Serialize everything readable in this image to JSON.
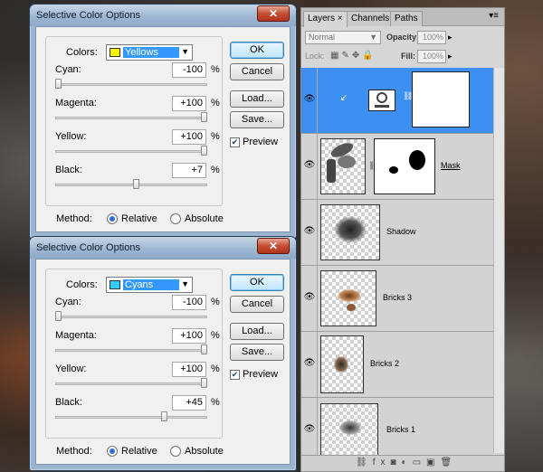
{
  "dialogs": [
    {
      "title": "Selective Color Options",
      "colors_label": "Colors:",
      "colors_value": "Yellows",
      "swatch": "#f5f500",
      "sliders": [
        {
          "label": "Cyan:",
          "value": "-100",
          "unit": "%",
          "level": 0.0
        },
        {
          "label": "Magenta:",
          "value": "+100",
          "unit": "%",
          "level": 1.0
        },
        {
          "label": "Yellow:",
          "value": "+100",
          "unit": "%",
          "level": 1.0
        },
        {
          "label": "Black:",
          "value": "+7",
          "unit": "%",
          "level": 0.535
        }
      ],
      "method_label": "Method:",
      "relative_label": "Relative",
      "absolute_label": "Absolute",
      "method_selected": "Relative",
      "ok": "OK",
      "cancel": "Cancel",
      "load": "Load...",
      "save": "Save...",
      "preview": "Preview",
      "preview_checked": true
    },
    {
      "title": "Selective Color Options",
      "colors_label": "Colors:",
      "colors_value": "Cyans",
      "swatch": "#33ccff",
      "sliders": [
        {
          "label": "Cyan:",
          "value": "-100",
          "unit": "%",
          "level": 0.0
        },
        {
          "label": "Magenta:",
          "value": "+100",
          "unit": "%",
          "level": 1.0
        },
        {
          "label": "Yellow:",
          "value": "+100",
          "unit": "%",
          "level": 1.0
        },
        {
          "label": "Black:",
          "value": "+45",
          "unit": "%",
          "level": 0.725
        }
      ],
      "method_label": "Method:",
      "relative_label": "Relative",
      "absolute_label": "Absolute",
      "method_selected": "Relative",
      "ok": "OK",
      "cancel": "Cancel",
      "load": "Load...",
      "save": "Save...",
      "preview": "Preview",
      "preview_checked": true
    }
  ],
  "layers_panel": {
    "tabs": [
      "Layers",
      "Channels",
      "Paths"
    ],
    "active_tab": "Layers",
    "blend_mode": "Normal",
    "opacity_label": "Opacity:",
    "opacity_value": "100%",
    "lock_label": "Lock:",
    "fill_label": "Fill:",
    "fill_value": "100%",
    "selection_color": "#3d90f2",
    "layers": [
      {
        "name": "",
        "kind": "adjustment",
        "selected": true
      },
      {
        "name": "Mask",
        "kind": "masked",
        "selected": false
      },
      {
        "name": "Shadow",
        "kind": "pixel",
        "selected": false
      },
      {
        "name": "Bricks 3",
        "kind": "pixel",
        "selected": false
      },
      {
        "name": "Bricks 2",
        "kind": "pixel",
        "selected": false
      },
      {
        "name": "Bricks 1",
        "kind": "pixel",
        "selected": false
      }
    ]
  }
}
